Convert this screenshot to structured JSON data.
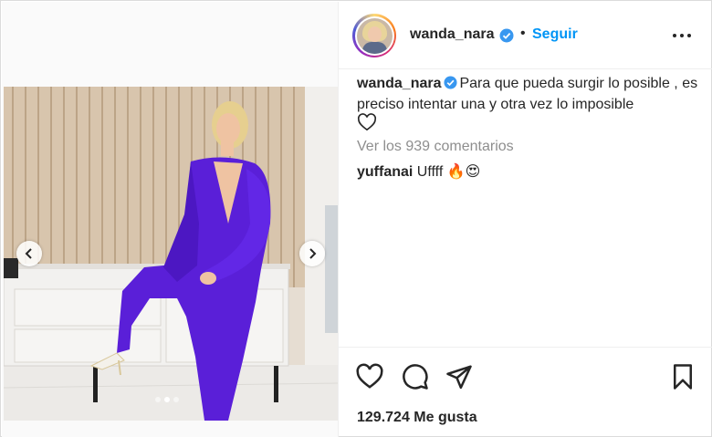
{
  "post": {
    "username": "wanda_nara",
    "separator": "•",
    "follow_label": "Seguir",
    "caption_text": "Para que pueda surgir lo posible , es preciso intentar una y otra vez lo imposible",
    "view_comments": "Ver los 939 comentarios",
    "comment": {
      "username": "yuffanai",
      "text": "Uffff 🔥😍"
    },
    "likes": "129.724 Me gusta"
  },
  "carousel": {
    "slide_count": 3,
    "active_slide": 2
  },
  "colors": {
    "accent": "#0095f6",
    "text": "#262626",
    "muted": "#8e8e8e",
    "outfit": "#5a1fd8",
    "border": "#dbdbdb"
  },
  "icons": [
    "verified-badge-icon",
    "more-options-icon",
    "heart-icon",
    "comment-icon",
    "share-icon",
    "bookmark-icon",
    "chevron-left-icon",
    "chevron-right-icon"
  ]
}
